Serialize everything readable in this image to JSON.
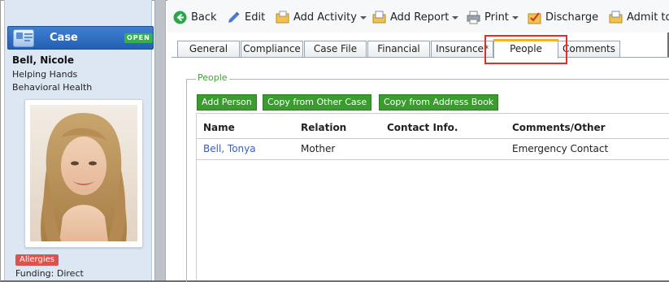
{
  "sidebar": {
    "case_title": "Case",
    "status_badge": "OPEN",
    "client_name": "Bell, Nicole",
    "program": "Helping Hands",
    "service": "Behavioral Health",
    "allergy_badge": "Allergies",
    "funding": "Funding: Direct"
  },
  "toolbar": {
    "back": "Back",
    "edit": "Edit",
    "add_activity": "Add Activity",
    "add_report": "Add Report",
    "print": "Print",
    "discharge": "Discharge",
    "admit_to": "Admit to"
  },
  "tabs": [
    {
      "label": "General"
    },
    {
      "label": "Compliance"
    },
    {
      "label": "Case File"
    },
    {
      "label": "Financial"
    },
    {
      "label": "Insurance*"
    },
    {
      "label": "People"
    },
    {
      "label": "Comments"
    }
  ],
  "active_tab": "People",
  "people": {
    "legend": "People",
    "buttons": {
      "add_person": "Add Person",
      "copy_other_case": "Copy from Other Case",
      "copy_address_book": "Copy from Address Book"
    },
    "columns": [
      "Name",
      "Relation",
      "Contact Info.",
      "Comments/Other"
    ],
    "rows": [
      {
        "name": "Bell, Tonya",
        "relation": "Mother",
        "contact": "",
        "comments": "Emergency Contact"
      }
    ]
  },
  "colors": {
    "accent_blue": "#2a66b8",
    "button_green": "#3a9b2e",
    "legend_green": "#3ea338",
    "highlight_red": "#e0302a",
    "allergy_red": "#d9534f",
    "link_blue": "#3a5fb8"
  }
}
